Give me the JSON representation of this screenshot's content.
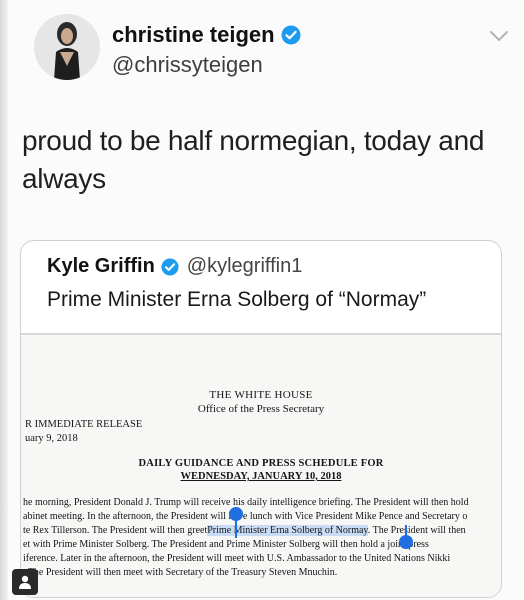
{
  "tweet": {
    "display_name": "christine teigen",
    "handle": "@chrissyteigen",
    "text": "proud to be half normegian, today and always",
    "verified_icon": "verified-badge-icon",
    "menu_icon": "chevron-down-icon"
  },
  "quoted": {
    "display_name": "Kyle Griffin",
    "handle": "@kylegriffin1",
    "text": "Prime Minister Erna Solberg of “Normay”"
  },
  "document": {
    "org": "THE WHITE HOUSE",
    "office": "Office of the Press Secretary",
    "release": "R IMMEDIATE RELEASE",
    "date": "uary 9, 2018",
    "schedule_title": "DAILY GUIDANCE AND PRESS SCHEDULE FOR",
    "schedule_date": "WEDNESDAY, JANUARY 10, 2018",
    "line1": "he morning, President Donald J. Trump will receive his daily intelligence briefing.  The President will then hold",
    "line2": "abinet meeting.  In the afternoon, the President will have lunch with Vice President Mike Pence and Secretary o",
    "line3_pre": "te Rex Tillerson. The President will then greet",
    "line3_hl": "Prime Minister Erna Solberg of Normay",
    "line3_post": ". The President will then",
    "line4": "et with Prime Minister Solberg. The President and Prime Minister Solberg will then hold a joint press",
    "line5": "iference.  Later in the afternoon, the President will meet with U.S. Ambassador to the United Nations Nikki",
    "line6": ". The President will then meet with Secretary of the Treasury Steven Mnuchin."
  },
  "colors": {
    "verified": "#1d9bf0",
    "selection": "#c9dcf6",
    "handle_pin": "#1f6fe0"
  }
}
